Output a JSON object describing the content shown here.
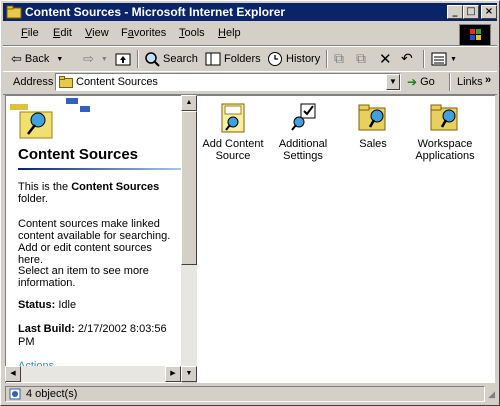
{
  "window": {
    "title": "Content Sources - Microsoft Internet Explorer"
  },
  "menubar": {
    "items": [
      {
        "u": "F",
        "rest": "ile"
      },
      {
        "u": "E",
        "rest": "dit"
      },
      {
        "u": "V",
        "rest": "iew"
      },
      {
        "pre": "F",
        "u": "a",
        "rest": "vorites"
      },
      {
        "u": "T",
        "rest": "ools"
      },
      {
        "u": "H",
        "rest": "elp"
      }
    ]
  },
  "toolbar": {
    "back": "Back",
    "search": "Search",
    "folders": "Folders",
    "history": "History"
  },
  "address": {
    "label": "Address",
    "value": "Content Sources",
    "go": "Go",
    "links": "Links"
  },
  "left_panel": {
    "title": "Content Sources",
    "intro_prefix": "This is the",
    "intro_bold": "Content Sources",
    "intro_suffix": "folder.",
    "description": "Content sources make linked content available for searching. Add or edit content sources here.",
    "select_hint": "Select an item to see more information.",
    "status_label": "Status:",
    "status_value": "Idle",
    "last_build_label": "Last Build:",
    "last_build_value": "2/17/2002 8:03:56 PM",
    "actions_label": "Actions"
  },
  "items": [
    {
      "label": "Add Content Source",
      "icon": "add-content-source-icon"
    },
    {
      "label": "Additional Settings",
      "icon": "additional-settings-icon"
    },
    {
      "label": "Sales",
      "icon": "folder-icon"
    },
    {
      "label": "Workspace Applications",
      "icon": "folder-icon"
    }
  ],
  "statusbar": {
    "text": "4 object(s)"
  }
}
